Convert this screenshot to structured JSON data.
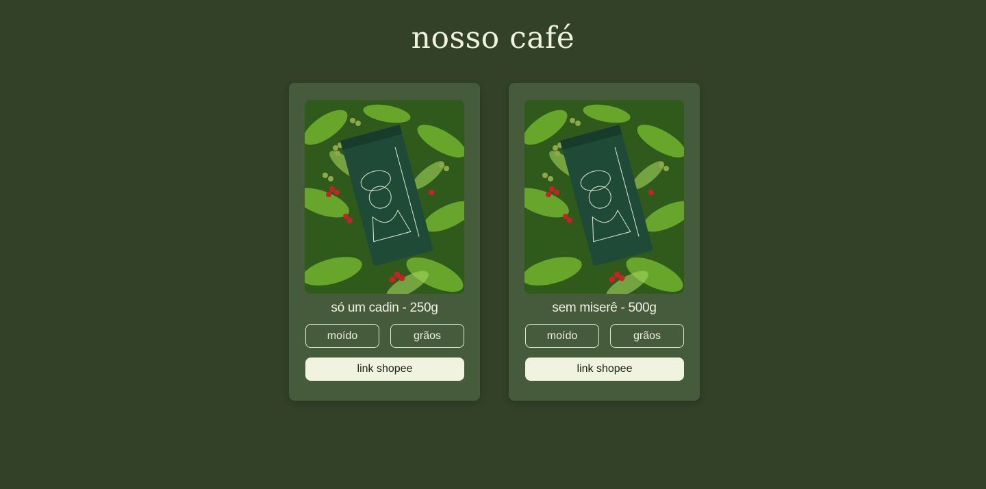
{
  "page": {
    "title": "nosso café",
    "background": "#324128"
  },
  "products": [
    {
      "name": "só um cadin - 250g",
      "options": [
        "moído",
        "grãos"
      ],
      "shop_label": "link shopee"
    },
    {
      "name": "sem miserê - 500g",
      "options": [
        "moído",
        "grãos"
      ],
      "shop_label": "link shopee"
    }
  ],
  "colors": {
    "card": "#455b3b",
    "text": "#f0f1e1",
    "button": "#eff3e0",
    "bag": "#1f4a38"
  }
}
